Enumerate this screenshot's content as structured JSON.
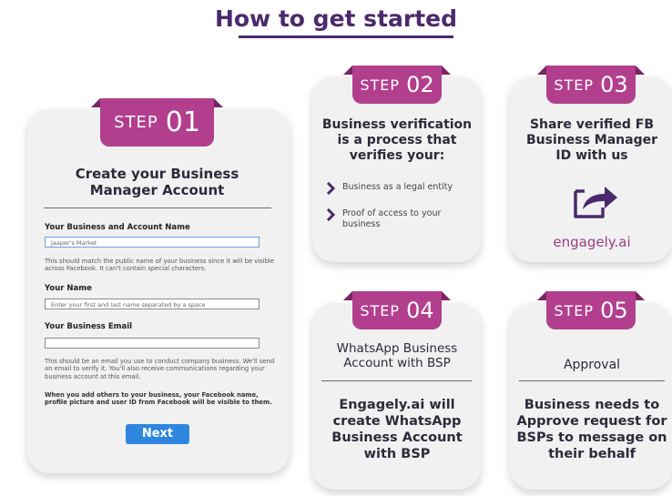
{
  "title": "How to get started",
  "colors": {
    "accent": "#b23f8e",
    "title": "#4a2a6c",
    "card": "#f1f1f1",
    "button": "#2e86de"
  },
  "step_word": "STEP",
  "step1": {
    "num": "01",
    "heading": "Create your Business Manager Account",
    "business_label": "Your Business and Account Name",
    "business_value": "Jaaper's Market",
    "business_help": "This should match the public name of your business since it will be visible across Facebook. It can't contain special characters.",
    "name_label": "Your Name",
    "name_placeholder": "Enter your first and last name separated by a space",
    "email_label": "Your Business Email",
    "email_value": "",
    "email_help": "This should be an email you use to conduct company business. We'll send an email to verify it. You'll also receive communications regarding your business account at this email.",
    "others_help": "When you add others to your business, your Facebook name, profile picture and user ID from Facebook will be visible to them.",
    "next_label": "Next"
  },
  "step2": {
    "num": "02",
    "heading": "Business verification is a process that verifies your:",
    "bullets": [
      "Business as a legal entity",
      "Proof of access to your business"
    ],
    "bullet_icon": "chevron-right-icon"
  },
  "step3": {
    "num": "03",
    "heading": "Share verified FB Business Manager ID with us",
    "icon": "share-icon",
    "brand": "engagely.ai"
  },
  "step4": {
    "num": "04",
    "heading": "WhatsApp Business Account with BSP",
    "body": "Engagely.ai will create WhatsApp Business Account with BSP"
  },
  "step5": {
    "num": "05",
    "heading": "Approval",
    "body": "Business needs to Approve request for BSPs to message on their behalf"
  }
}
